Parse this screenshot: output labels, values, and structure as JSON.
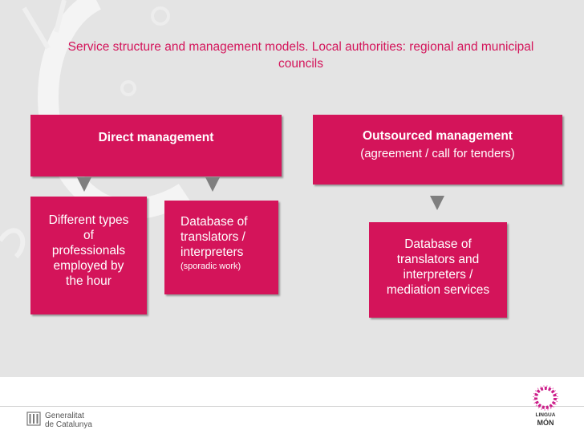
{
  "title": "Service structure and management models. Local authorities: regional and municipal councils",
  "direct": {
    "label": "Direct management",
    "hourly_lines": [
      "Different types",
      "of",
      "professionals",
      "employed by",
      "the hour"
    ],
    "database_lines": [
      "Database of",
      "translators /",
      "interpreters"
    ],
    "database_note": "(sporadic work)"
  },
  "outsourced": {
    "label": "Outsourced management",
    "sublabel": "(agreement / call for tenders)",
    "database_lines": [
      "Database of",
      "translators and",
      "interpreters /",
      "mediation services"
    ]
  },
  "footer": {
    "generalitat_line1": "Generalitat",
    "generalitat_line2": "de Catalunya",
    "linguamon_line1": "LINGUA",
    "linguamon_line2": "MÓN"
  },
  "colors": {
    "accent": "#d4145a",
    "arrow": "#7f7f7f",
    "background": "#e4e4e4"
  }
}
